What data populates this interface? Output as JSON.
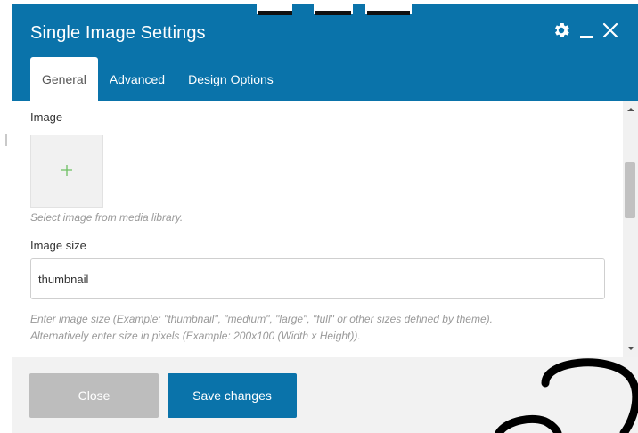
{
  "dialog": {
    "title": "Single Image Settings",
    "icons": [
      "gear-icon",
      "minimize-icon",
      "close-icon"
    ]
  },
  "tabs": [
    {
      "label": "General",
      "active": true
    },
    {
      "label": "Advanced",
      "active": false
    },
    {
      "label": "Design Options",
      "active": false
    }
  ],
  "fields": {
    "image": {
      "label": "Image",
      "add_icon": "plus-icon",
      "hint": "Select image from media library."
    },
    "image_size": {
      "label": "Image size",
      "value": "thumbnail",
      "hint_line1": "Enter image size (Example: \"thumbnail\", \"medium\", \"large\", \"full\" or other sizes defined by theme).",
      "hint_line2": "Alternatively enter size in pixels (Example: 200x100 (Width x Height))."
    }
  },
  "footer": {
    "close_label": "Close",
    "save_label": "Save changes"
  },
  "colors": {
    "header": "#0a73aa",
    "save_button": "#0a73aa",
    "close_button": "#bdbdbd",
    "plus": "#6cbf62"
  }
}
